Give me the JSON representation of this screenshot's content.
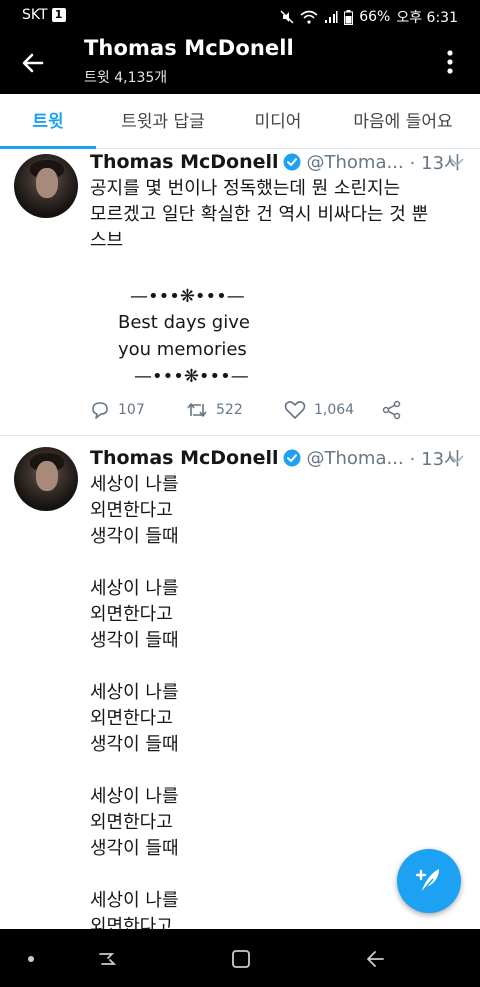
{
  "status": {
    "carrier": "SKT",
    "carrier_badge": "1",
    "battery": "66%",
    "time": "오후 6:31"
  },
  "header": {
    "title": "Thomas McDonell",
    "subtitle": "트윗 4,135개"
  },
  "tabs": [
    {
      "label": "트윗",
      "active": true
    },
    {
      "label": "트윗과 답글"
    },
    {
      "label": "미디어"
    },
    {
      "label": "마음에 들어요"
    }
  ],
  "tweets": [
    {
      "name": "Thomas McDonell",
      "handle": "@Thoma...",
      "time": "· 13시",
      "text": "공지를 몇 번이나 정독했는데 뭔 소린지는\n모르겠고 일단 확실한 건 역시 비싸다는 것 뿐\n스브",
      "quote_top": "—•••❋•••—",
      "quote_line1": "Best days give",
      "quote_line2": "you memories",
      "quote_bottom": "—•••❋•••—",
      "replies": "107",
      "retweets": "522",
      "likes": "1,064"
    },
    {
      "name": "Thomas McDonell",
      "handle": "@Thoma...",
      "time": "· 13시",
      "text": "세상이 나를\n외면한다고\n생각이 들때\n\n세상이 나를\n외면한다고\n생각이 들때\n\n세상이 나를\n외면한다고\n생각이 들때\n\n세상이 나를\n외면한다고\n생각이 들때\n\n세상이 나를\n외면한다고"
    }
  ],
  "colors": {
    "accent": "#1da1f2",
    "text": "#14171a",
    "muted": "#657786"
  },
  "icons": {
    "back": "arrow-left-icon",
    "more": "vertical-dots-icon",
    "compose": "feather-plus-icon"
  }
}
